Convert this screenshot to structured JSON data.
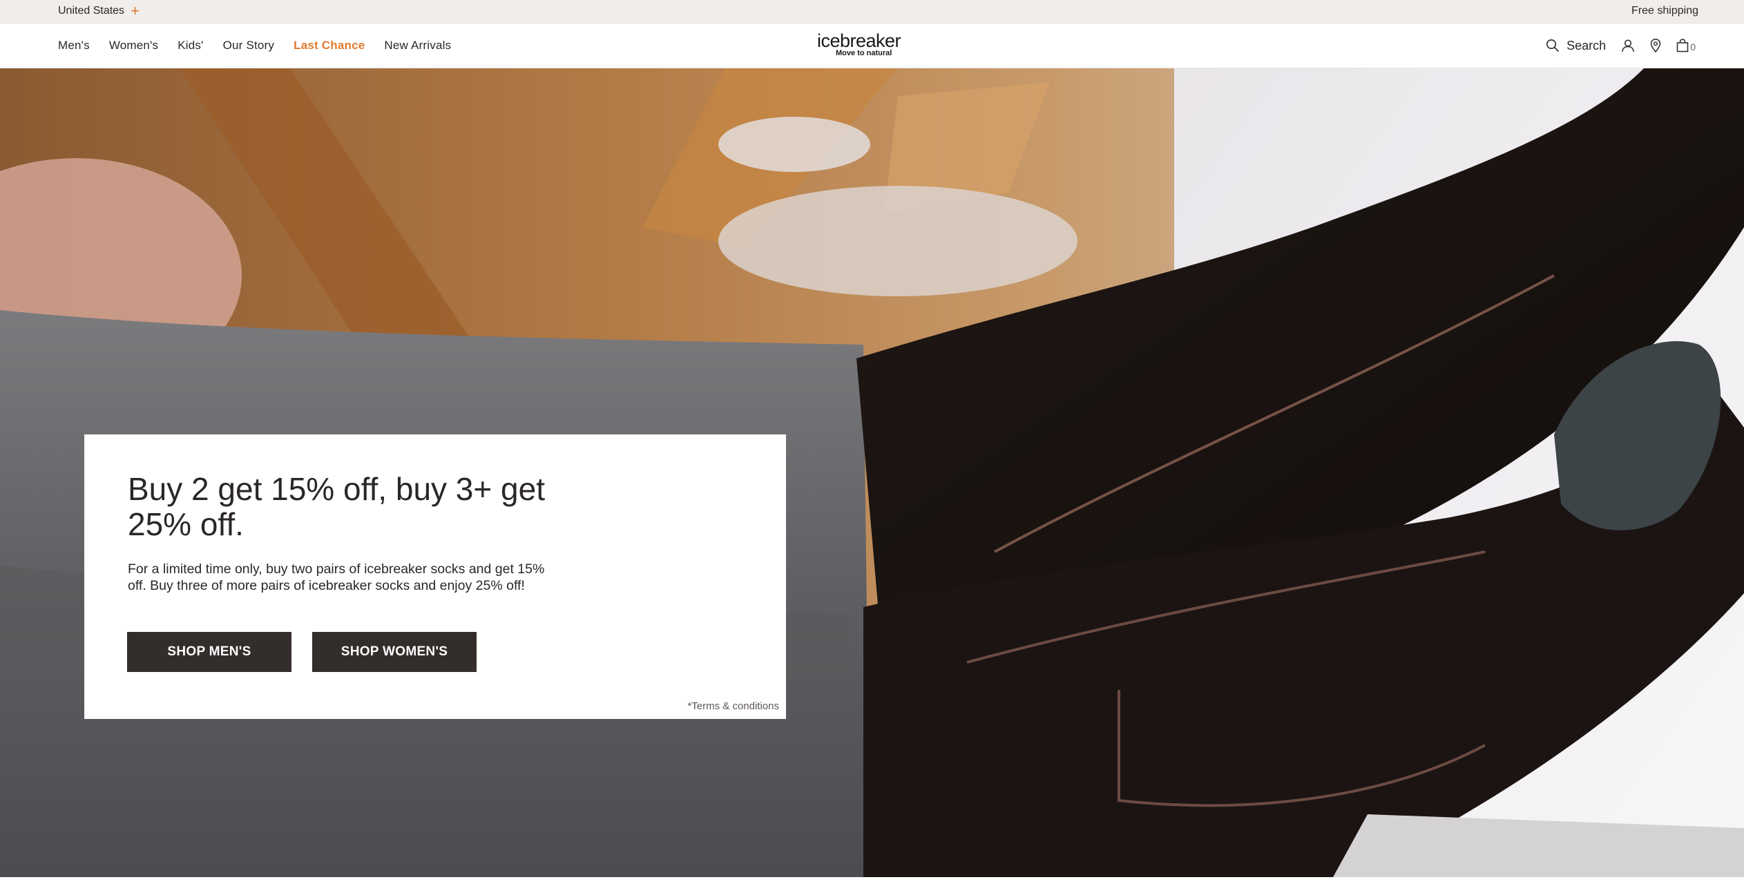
{
  "utility": {
    "locale": "United States",
    "free_shipping": "Free shipping"
  },
  "nav": {
    "items": [
      "Men's",
      "Women's",
      "Kids'",
      "Our Story",
      "Last Chance",
      "New Arrivals"
    ]
  },
  "brand": {
    "name": "icebreaker",
    "tagline": "Move to natural"
  },
  "tools": {
    "search_label": "Search",
    "bag_count": "0"
  },
  "promo": {
    "title": "Buy 2 get 15% off, buy 3+ get 25% off.",
    "body": "For a limited time only, buy two pairs of icebreaker socks and get 15% off. Buy three of more pairs of icebreaker socks and enjoy 25% off!",
    "shop_mens": "SHOP MEN'S",
    "shop_womens": "SHOP WOMEN'S",
    "terms": "*Terms & conditions"
  },
  "colors": {
    "accent": "#e07a2e",
    "button": "#332e2c",
    "utility_bar": "#f0edea"
  }
}
